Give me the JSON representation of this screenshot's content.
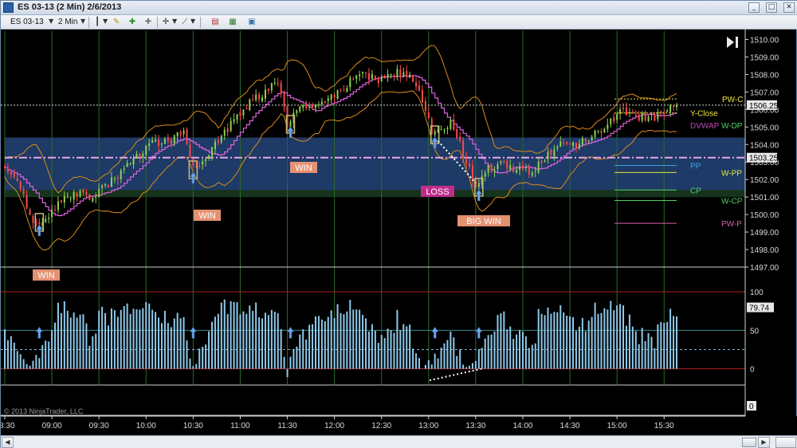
{
  "window": {
    "title": "ES 03-13 (2 Min)  2/6/2013",
    "minimize": "_",
    "maximize": "□",
    "close": "✕"
  },
  "toolbar": {
    "instrument": "ES 03-13",
    "interval": "2 Min"
  },
  "colors": {
    "background": "#000000",
    "candle_up": "#8fd14f",
    "candle_down": "#ff4a4a",
    "bollinger": "#d98b1c",
    "vwap": "#e060e0",
    "value_band": "#1e3a66",
    "price_line": "#d8d8d8",
    "oscillator_bar": "#8ec9ea",
    "annotation_box": "#e49172",
    "loss_box": "#c02c8c",
    "separator": "#cfcfcf",
    "grid": "#2a6a2a"
  },
  "copyright": "© 2013 NinjaTrader, LLC",
  "price_axis": {
    "ticks": [
      "1510.00",
      "1509.00",
      "1508.00",
      "1507.00",
      "1506.00",
      "1505.00",
      "1504.00",
      "1503.00",
      "1502.00",
      "1501.00",
      "1500.00",
      "1499.00",
      "1498.00",
      "1497.00"
    ],
    "last_price": "1506.25",
    "current_marker": "1503.25"
  },
  "level_labels": [
    {
      "text": "PW-C",
      "color": "#f0e640"
    },
    {
      "text": "Y-Close",
      "color": "#f0e640"
    },
    {
      "text": "DVWAP",
      "color": "#c044b8"
    },
    {
      "text": "W-DP",
      "color": "#52d06a"
    },
    {
      "text": "PP",
      "color": "#3aa7e8"
    },
    {
      "text": "W-PP",
      "color": "#e8e840"
    },
    {
      "text": "CP",
      "color": "#52d06a"
    },
    {
      "text": "W-CP",
      "color": "#52d06a"
    },
    {
      "text": "PW-P",
      "color": "#e05bb0"
    }
  ],
  "oscillator_axis": {
    "ticks": [
      "100",
      "50",
      "0"
    ],
    "current_value": "79.74"
  },
  "bottom_panel_axis": {
    "ticks": [
      "0"
    ]
  },
  "time_axis": {
    "ticks": [
      "08:30",
      "09:00",
      "09:30",
      "10:00",
      "10:30",
      "11:00",
      "11:30",
      "12:00",
      "12:30",
      "13:00",
      "13:30",
      "14:00",
      "14:30",
      "15:00",
      "15:30"
    ]
  },
  "annotations": [
    {
      "text": "WIN"
    },
    {
      "text": "WIN"
    },
    {
      "text": "WIN"
    },
    {
      "text": "LOSS"
    },
    {
      "text": "BIG WIN"
    }
  ],
  "chart_data": {
    "type": "candlestick",
    "instrument": "ES 03-13",
    "interval": "2 Min",
    "date": "2/6/2013",
    "ylim": [
      1497,
      1510.25
    ],
    "oscillator_ylim": [
      -20,
      130
    ],
    "close_path": [
      [
        "08:30",
        1502.5
      ],
      [
        "08:40",
        1501.6
      ],
      [
        "08:46",
        1499.8
      ],
      [
        "08:54",
        1499.6
      ],
      [
        "09:04",
        1500.6
      ],
      [
        "09:14",
        1501.2
      ],
      [
        "09:24",
        1501.0
      ],
      [
        "09:34",
        1501.6
      ],
      [
        "09:44",
        1502.4
      ],
      [
        "09:54",
        1503.4
      ],
      [
        "10:04",
        1504.0
      ],
      [
        "10:14",
        1504.2
      ],
      [
        "10:24",
        1504.6
      ],
      [
        "10:30",
        1502.6
      ],
      [
        "10:36",
        1503.2
      ],
      [
        "10:46",
        1504.2
      ],
      [
        "10:56",
        1505.4
      ],
      [
        "11:06",
        1506.4
      ],
      [
        "11:16",
        1507.0
      ],
      [
        "11:24",
        1507.6
      ],
      [
        "11:30",
        1505.2
      ],
      [
        "11:38",
        1506.0
      ],
      [
        "11:48",
        1506.2
      ],
      [
        "12:00",
        1506.8
      ],
      [
        "12:10",
        1507.6
      ],
      [
        "12:20",
        1508.0
      ],
      [
        "12:30",
        1507.6
      ],
      [
        "12:40",
        1508.1
      ],
      [
        "12:50",
        1507.8
      ],
      [
        "12:56",
        1506.6
      ],
      [
        "13:02",
        1504.8
      ],
      [
        "13:08",
        1505.0
      ],
      [
        "13:14",
        1505.2
      ],
      [
        "13:20",
        1504.0
      ],
      [
        "13:26",
        1502.6
      ],
      [
        "13:30",
        1501.6
      ],
      [
        "13:38",
        1502.6
      ],
      [
        "13:46",
        1502.8
      ],
      [
        "13:56",
        1502.6
      ],
      [
        "14:04",
        1502.4
      ],
      [
        "14:14",
        1503.2
      ],
      [
        "14:24",
        1504.0
      ],
      [
        "14:34",
        1504.0
      ],
      [
        "14:44",
        1504.4
      ],
      [
        "14:54",
        1505.2
      ],
      [
        "15:04",
        1506.0
      ],
      [
        "15:14",
        1505.6
      ],
      [
        "15:24",
        1505.6
      ],
      [
        "15:30",
        1506.0
      ],
      [
        "15:36",
        1506.4
      ]
    ],
    "levels": [
      {
        "name": "PW-C",
        "value": 1506.6
      },
      {
        "name": "Y-Close",
        "value": 1505.8
      },
      {
        "name": "DVWAP",
        "value": 1505.1
      },
      {
        "name": "W-DP",
        "value": 1505.1
      },
      {
        "name": "PP",
        "value": 1502.8
      },
      {
        "name": "W-PP",
        "value": 1502.4
      },
      {
        "name": "CP",
        "value": 1501.4
      },
      {
        "name": "W-CP",
        "value": 1500.8
      },
      {
        "name": "PW-P",
        "value": 1499.5
      }
    ],
    "value_band": [
      1501.0,
      1504.4
    ],
    "dashed_level": 1503.25,
    "reference_line": 1506.25,
    "oscillator_levels": [
      100,
      50,
      0
    ],
    "trades": [
      {
        "label": "WIN",
        "time": "08:52",
        "price": 1499.6
      },
      {
        "label": "WIN",
        "time": "10:30",
        "price": 1502.6
      },
      {
        "label": "WIN",
        "time": "11:32",
        "price": 1505.2
      },
      {
        "label": "LOSS",
        "time": "13:04",
        "price": 1504.6
      },
      {
        "label": "BIG WIN",
        "time": "13:32",
        "price": 1501.6
      }
    ]
  }
}
